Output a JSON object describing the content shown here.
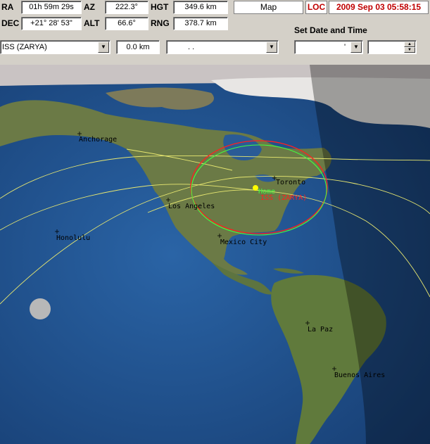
{
  "panel": {
    "ra_label": "RA",
    "ra_value": "01h 59m 29s",
    "az_label": "AZ",
    "az_value": "222.3°",
    "hgt_label": "HGT",
    "hgt_value": "349.6 km",
    "map_button": "Map",
    "loc_label": "LOC",
    "datetime": "2009 Sep 03   05:58:15",
    "dec_label": "DEC",
    "dec_value": "+21° 28' 53\"",
    "alt_label": "ALT",
    "alt_value": "66.6°",
    "rng_label": "RNG",
    "rng_value": "378.7 km",
    "set_date_time": "Set  Date and Time",
    "satellite_select": "ISS (ZARYA)",
    "offset_value": "0.0 km",
    "third_combo": ".          .",
    "date_combo": "'",
    "time_spinner": ""
  },
  "map": {
    "labels": {
      "anchorage": "Anchorage",
      "honolulu": "Honolulu",
      "los_angeles": "Los Angeles",
      "mexico_city": "Mexico City",
      "toronto": "Toronto",
      "home": "Home",
      "iss": "ISS (ZARYA)",
      "la_paz": "La Paz",
      "buenos_aires": "Buenos Aires"
    },
    "colors": {
      "ocean": "#1f4f8f",
      "land": "#5a6a3a",
      "ground_track": "#e8e870",
      "footprint_green": "#40ff40",
      "footprint_red": "#ff2020",
      "iss_marker": "#ffff00",
      "night_shade": "#000000"
    }
  }
}
